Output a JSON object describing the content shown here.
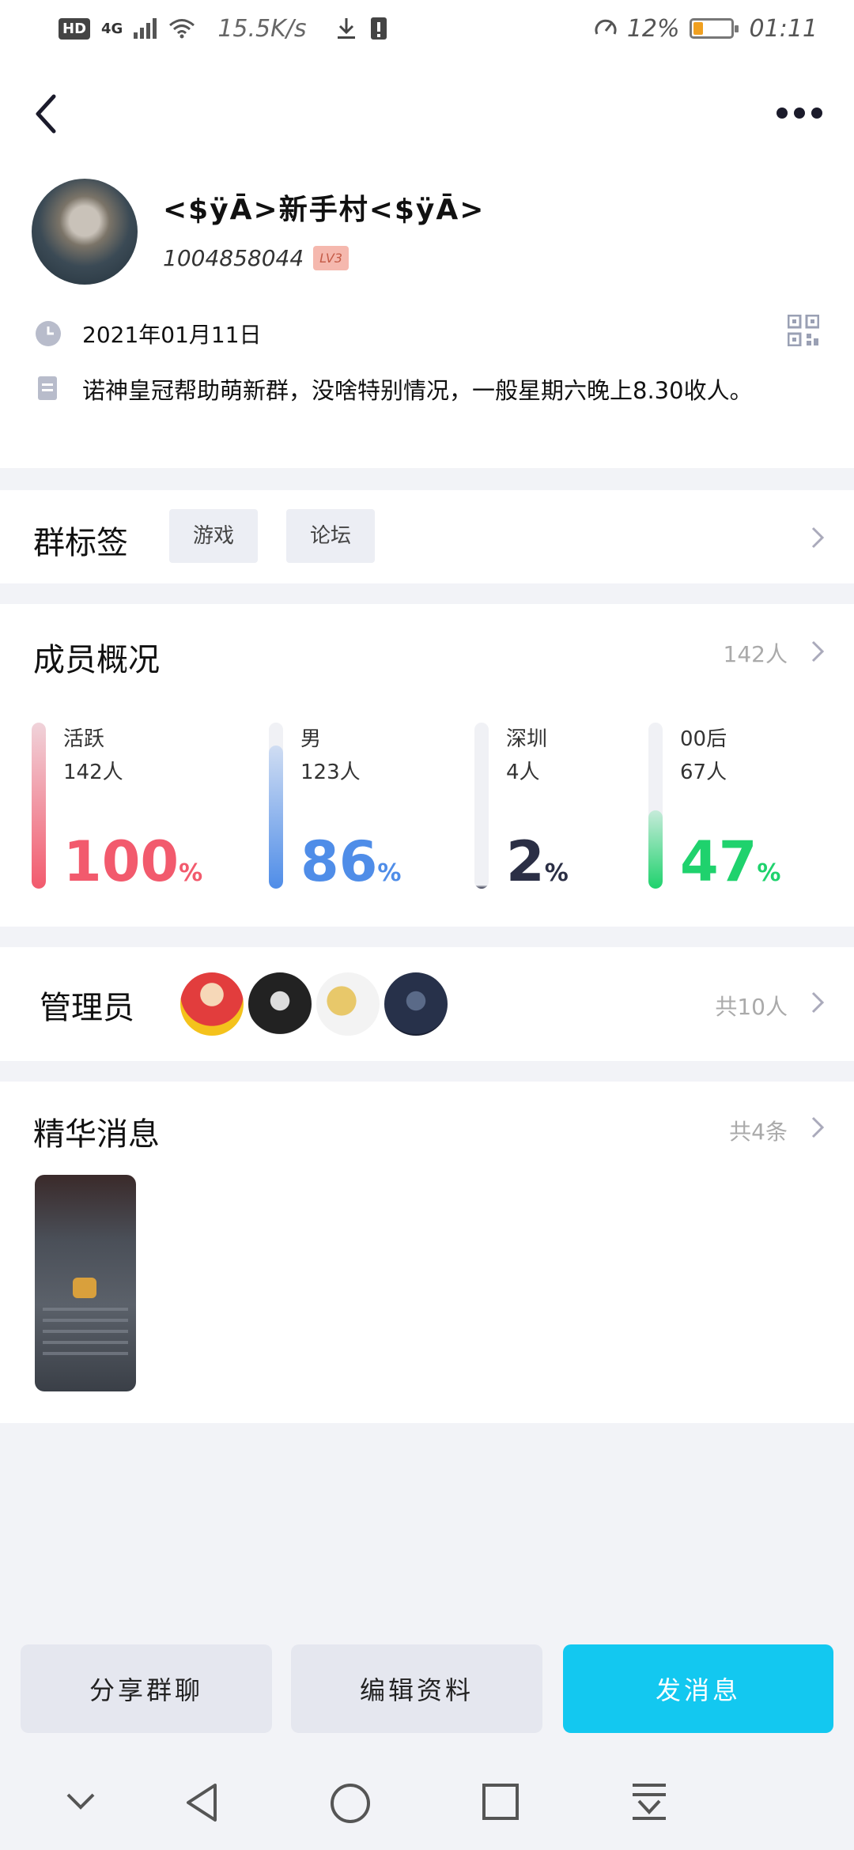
{
  "status_bar": {
    "hd": "HD",
    "signal": "4G",
    "net_speed": "15.5K/s",
    "battery_percent": "12%",
    "time": "01:11"
  },
  "header": {
    "group_name": "<$ÿĀ>新手村<$ÿĀ>",
    "group_id": "1004858044",
    "level_badge": "LV3",
    "date": "2021年01月11日",
    "intro": "诺神皇冠帮助萌新群，没啥特别情况，一般星期六晚上8.30收人。"
  },
  "tags": {
    "title": "群标签",
    "items": [
      "游戏",
      "论坛"
    ]
  },
  "members": {
    "title": "成员概况",
    "total": "142人",
    "stats": [
      {
        "label": "活跃",
        "count": "142人",
        "percent": 100,
        "color": "#f25a6d"
      },
      {
        "label": "男",
        "count": "123人",
        "percent": 86,
        "color": "#4f8de8"
      },
      {
        "label": "深圳",
        "count": "4人",
        "percent": 2,
        "color": "#2b2f45"
      },
      {
        "label": "00后",
        "count": "67人",
        "percent": 47,
        "color": "#1fd26d"
      }
    ]
  },
  "admins": {
    "title": "管理员",
    "count": "共10人"
  },
  "featured": {
    "title": "精华消息",
    "count": "共4条"
  },
  "actions": {
    "share": "分享群聊",
    "edit": "编辑资料",
    "send": "发消息"
  },
  "colors": {
    "primary": "#13c8f0",
    "level_bg": "#f5b8ae"
  }
}
